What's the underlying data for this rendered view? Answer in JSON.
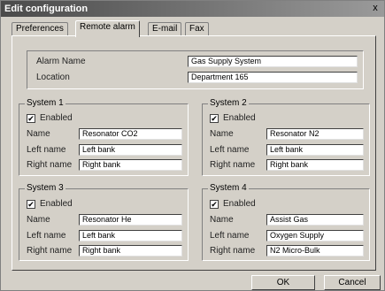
{
  "window": {
    "title": "Edit configuration",
    "close_glyph": "x"
  },
  "tabs": [
    {
      "label": "Preferences"
    },
    {
      "label": "Remote alarm",
      "active": true
    },
    {
      "label": "E-mail"
    },
    {
      "label": "Fax"
    }
  ],
  "alarm": {
    "name_label": "Alarm Name",
    "name_value": "Gas Supply System",
    "location_label": "Location",
    "location_value": "Department 165"
  },
  "systems": [
    {
      "title": "System 1",
      "enabled_label": "Enabled",
      "enabled": true,
      "name_label": "Name",
      "name_value": "Resonator CO2",
      "left_label": "Left name",
      "left_value": "Left bank",
      "right_label": "Right name",
      "right_value": "Right bank"
    },
    {
      "title": "System 2",
      "enabled_label": "Enabled",
      "enabled": true,
      "name_label": "Name",
      "name_value": "Resonator N2",
      "left_label": "Left name",
      "left_value": "Left bank",
      "right_label": "Right name",
      "right_value": "Right bank"
    },
    {
      "title": "System 3",
      "enabled_label": "Enabled",
      "enabled": true,
      "name_label": "Name",
      "name_value": "Resonator He",
      "left_label": "Left name",
      "left_value": "Left bank",
      "right_label": "Right name",
      "right_value": "Right bank"
    },
    {
      "title": "System 4",
      "enabled_label": "Enabled",
      "enabled": true,
      "name_label": "Name",
      "name_value": "Assist Gas",
      "left_label": "Left name",
      "left_value": "Oxygen Supply",
      "right_label": "Right name",
      "right_value": "N2 Micro-Bulk"
    }
  ],
  "buttons": {
    "ok": "OK",
    "cancel": "Cancel"
  },
  "check_glyph": "✔"
}
